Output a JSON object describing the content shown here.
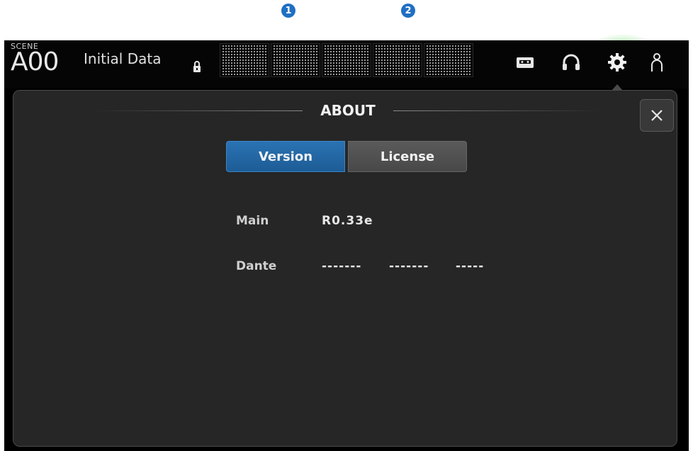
{
  "callouts": [
    "1",
    "2"
  ],
  "topbar": {
    "scene_label": "SCENE",
    "scene_number": "A00",
    "scene_title": "Initial Data",
    "icons": [
      "lock-icon",
      "recorder-icon",
      "headphones-icon",
      "gear-icon",
      "user-icon"
    ],
    "active_glow_color": "#50dc50"
  },
  "dialog": {
    "title": "ABOUT",
    "close_label": "×",
    "tabs": [
      {
        "label": "Version",
        "active": true
      },
      {
        "label": "License",
        "active": false
      }
    ],
    "info": {
      "main_label": "Main",
      "main_value": "R0.33e",
      "dante_label": "Dante",
      "dante_values": [
        "-------",
        "-------",
        "-----"
      ]
    }
  },
  "colors": {
    "accent": "#1f6fc4",
    "tab_active": "#2a73b3",
    "tab_inactive": "#555555",
    "panel_bg": "#262626"
  }
}
